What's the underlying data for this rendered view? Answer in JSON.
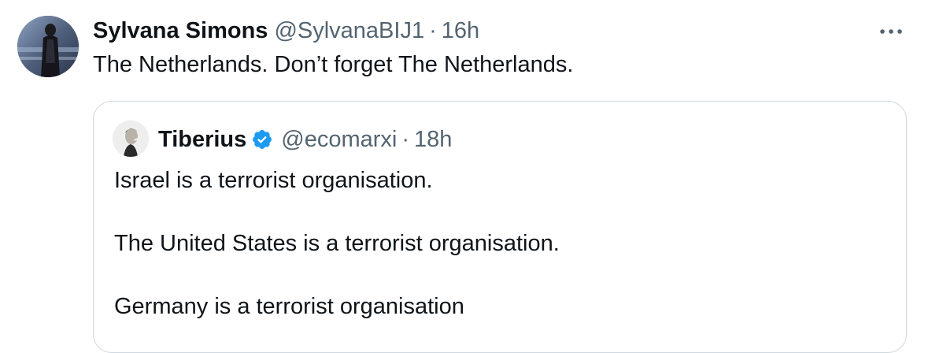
{
  "tweet": {
    "author_name": "Sylvana Simons",
    "author_handle": "@SylvanaBIJ1",
    "separator": "·",
    "time": "16h",
    "text": "The Netherlands. Don’t forget The Netherlands.",
    "more_icon": "more-horizontal-icon"
  },
  "quote": {
    "author_name": "Tiberius",
    "verified_icon": "verified-badge-icon",
    "author_handle": "@ecomarxi",
    "separator": "·",
    "time": "18h",
    "lines": [
      "Israel is a terrorist organisation.",
      "The United States is a terrorist organisation.",
      "Germany is a terrorist organisation"
    ]
  },
  "colors": {
    "text_primary": "#0f1419",
    "text_secondary": "#536471",
    "border": "#cfd9de",
    "verified": "#1d9bf0"
  }
}
